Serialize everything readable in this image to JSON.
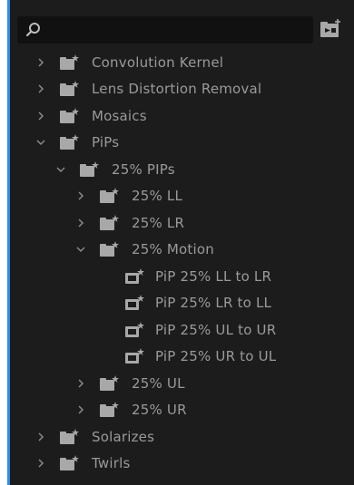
{
  "search": {
    "value": "",
    "placeholder": ""
  },
  "icons": {
    "search": "search-icon",
    "new_bin": "new-bin-icon",
    "folder": "bin-folder-icon",
    "effect": "effect-preset-icon"
  },
  "colors": {
    "panel_bg": "#1c1c1c",
    "text": "#9a9a9a",
    "accent": "#2d8ceb",
    "icon": "#a8a8a8"
  },
  "tree": {
    "convolution_kernel": "Convolution Kernel",
    "lens_distortion_removal": "Lens Distortion Removal",
    "mosaics": "Mosaics",
    "pips": "PiPs",
    "pips_25": "25% PIPs",
    "ll_25": "25% LL",
    "lr_25": "25% LR",
    "motion_25": "25% Motion",
    "pip_ll_to_lr": "PiP 25% LL to LR",
    "pip_lr_to_ll": "PiP 25% LR to LL",
    "pip_ul_to_ur": "PiP 25% UL to UR",
    "pip_ur_to_ul": "PiP 25% UR to UL",
    "ul_25": "25% UL",
    "ur_25": "25% UR",
    "solarizes": "Solarizes",
    "twirls": "Twirls"
  }
}
